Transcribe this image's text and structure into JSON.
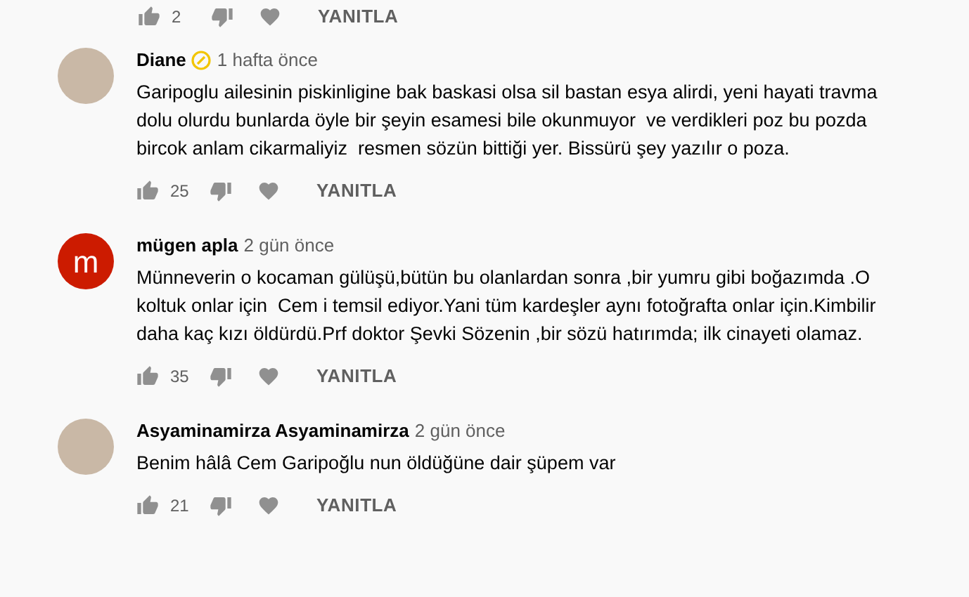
{
  "top_actions": {
    "likes": "2",
    "reply": "YANITLA"
  },
  "comments": [
    {
      "avatar": {
        "kind": "photo"
      },
      "author": "Diane",
      "verified": true,
      "time": "1 hafta önce",
      "text": "Garipoglu ailesinin piskinligine bak baskasi olsa sil bastan esya alirdi, yeni hayati travma dolu olurdu bunlarda öyle bir şeyin esamesi bile okunmuyor  ve verdikleri poz bu pozda bircok anlam cikarmaliyiz  resmen sözün bittiği yer. Bissürü şey yazılır o poza.",
      "likes": "25",
      "reply": "YANITLA"
    },
    {
      "avatar": {
        "kind": "letter",
        "initial": "m",
        "color": "#cc1b00"
      },
      "author": "mügen apla",
      "verified": false,
      "time": "2 gün önce",
      "text": "Münneverin o kocaman gülüşü,bütün bu olanlardan sonra ,bir yumru gibi boğazımda .O koltuk onlar için  Cem i temsil ediyor.Yani tüm kardeşler aynı fotoğrafta onlar için.Kimbilir daha kaç kızı öldürdü.Prf doktor Şevki Sözenin ,bir sözü hatırımda; ilk cinayeti olamaz.",
      "likes": "35",
      "reply": "YANITLA"
    },
    {
      "avatar": {
        "kind": "photo"
      },
      "author": "Asyaminamirza Asyaminamirza",
      "verified": false,
      "time": "2 gün önce",
      "text": "Benim hâlâ Cem Garipoğlu nun öldüğüne dair şüpem var",
      "likes": "21",
      "reply": "YANITLA"
    }
  ]
}
